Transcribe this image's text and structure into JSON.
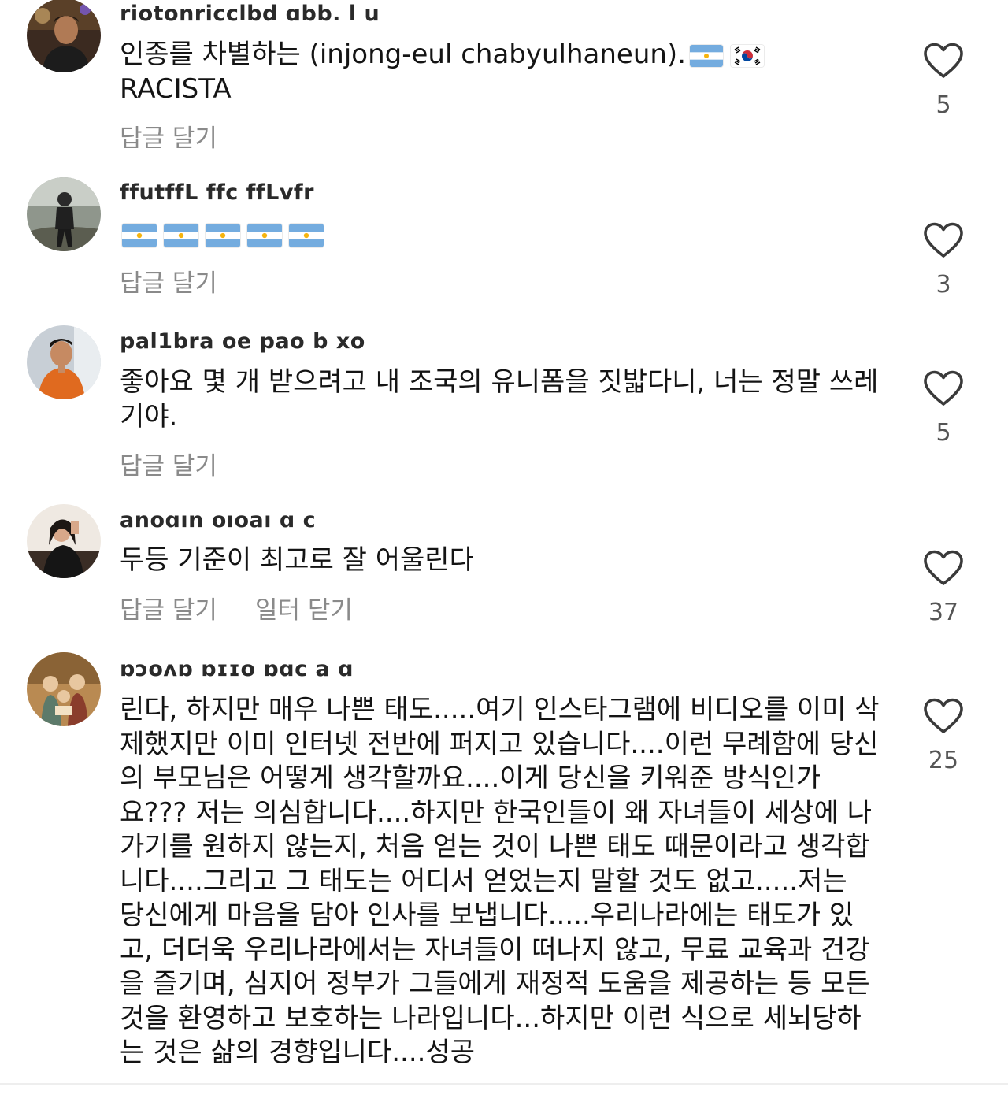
{
  "comments": [
    {
      "username": "riotonricclbd ɑbb. l  u",
      "text_part1": "인종를 차별하는 (injong-eul chabyulhaneun).",
      "text_part2": "RACISTA",
      "reply_label": "답글 달기",
      "likes": "5",
      "flags": [
        "argentina-flag",
        "south-korea-flag"
      ]
    },
    {
      "username": "ffutffL ffc ffLvfr",
      "flags": [
        "argentina-flag",
        "argentina-flag",
        "argentina-flag",
        "argentina-flag",
        "argentina-flag"
      ],
      "reply_label": "답글 달기",
      "likes": "3"
    },
    {
      "username": "pal1bra oe pao b    xo",
      "text": "좋아요 몇 개 받으려고 내 조국의 유니폼을 짓밟다니, 너는 정말 쓰레기야.",
      "reply_label": "답글 달기",
      "likes": "5"
    },
    {
      "username": "anoɑın oıoaı ɑ c",
      "text": "두등 기준이 최고로 잘 어울린다",
      "reply_label": "답글 달기",
      "extra_label": "일터 닫기",
      "likes": "37"
    },
    {
      "username": "ɒɔoʌɒ ɒɪɪo ɒɑc   a ɑ",
      "text": "린다, 하지만 매우 나쁜 태도.....여기 인스타그램에 비디오를 이미 삭제했지만 이미 인터넷 전반에 퍼지고 있습니다....이런 무례함에 당신의 부모님은 어떻게 생각할까요....이게 당신을 키워준 방식인가요??? 저는 의심합니다....하지만 한국인들이 왜 자녀들이 세상에 나가기를 원하지 않는지, 처음 얻는 것이 나쁜 태도 때문이라고 생각합니다....그리고 그 태도는 어디서 얻었는지 말할 것도 없고.....저는 당신에게 마음을 담아 인사를 보냅니다.....우리나라에는 태도가 있고, 더더욱 우리나라에서는 자녀들이 떠나지 않고, 무료 교육과 건강을 즐기며, 심지어 정부가 그들에게 재정적 도움을 제공하는 등 모든 것을 환영하고 보호하는 나라입니다...하지만 이런 식으로 세뇌당하는 것은 삶의 경향입니다....성공",
      "likes": "25"
    }
  ],
  "icons": {
    "like": "heart-outline-icon"
  },
  "colors": {
    "text": "#141414",
    "username": "#2a2a2a",
    "muted": "#8a8a8a",
    "like_count": "#555555"
  }
}
